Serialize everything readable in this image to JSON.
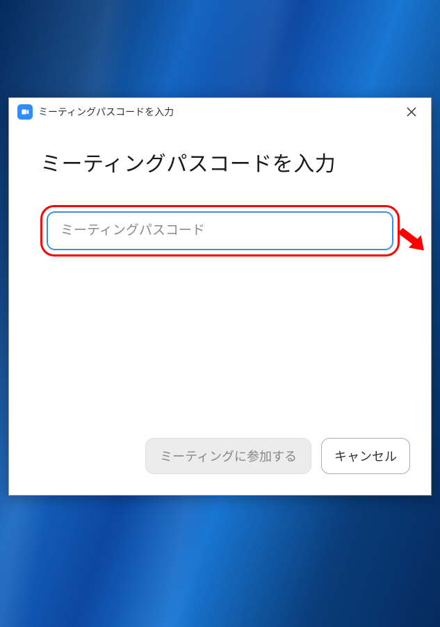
{
  "dialog": {
    "title": "ミーティングパスコードを入力",
    "heading": "ミーティングパスコードを入力",
    "passcode_placeholder": "ミーティングパスコード",
    "passcode_value": "",
    "join_label": "ミーティングに参加する",
    "cancel_label": "キャンセル"
  }
}
